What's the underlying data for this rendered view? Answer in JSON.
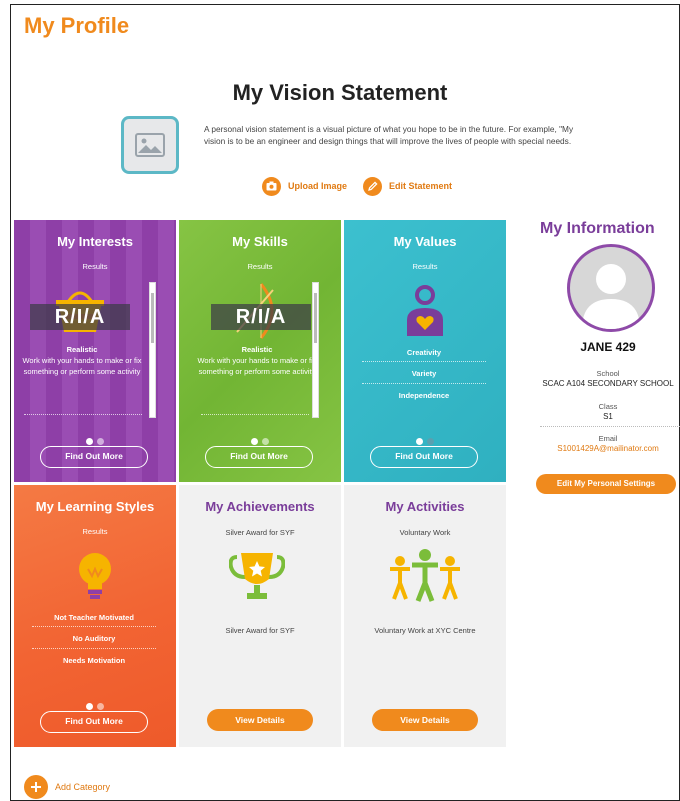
{
  "page": {
    "title": "My Profile"
  },
  "vision": {
    "title": "My Vision Statement",
    "description": "A personal vision statement is a visual picture of what you hope to be in the future. For example, \"My vision is to be an engineer and design things that will improve the lives of people with special needs.",
    "upload_label": "Upload Image",
    "edit_label": "Edit Statement"
  },
  "cards": {
    "interests": {
      "title": "My Interests",
      "results": "Results",
      "code": "R/I/A",
      "type": "Realistic",
      "desc": "Work with your hands to make or fix something or perform some activity",
      "button": "Find Out More",
      "color": "#8e3fa7"
    },
    "skills": {
      "title": "My Skills",
      "results": "Results",
      "code": "R/I/A",
      "type": "Realistic",
      "desc": "Work with your hands to make or fix something or perform some activity",
      "button": "Find Out More",
      "color": "#7bbd3a"
    },
    "values": {
      "title": "My Values",
      "results": "Results",
      "items": [
        "Creativity",
        "Variety",
        "Independence"
      ],
      "button": "Find Out More",
      "color": "#35b8c8"
    },
    "learning": {
      "title": "My Learning Styles",
      "results": "Results",
      "items": [
        "Not Teacher Motivated",
        "No Auditory",
        "Needs Motivation"
      ],
      "button": "Find Out More",
      "color": "#f26a35"
    },
    "achievements": {
      "title": "My Achievements",
      "top": "Silver Award for SYF",
      "bottom": "Silver Award for SYF",
      "button": "View Details"
    },
    "activities": {
      "title": "My Activities",
      "top": "Voluntary Work",
      "bottom": "Voluntary Work at XYC Centre",
      "button": "View Details"
    }
  },
  "info": {
    "title": "My Information",
    "name": "JANE 429",
    "school_label": "School",
    "school": "SCAC A104 SECONDARY SCHOOL",
    "class_label": "Class",
    "class": "S1",
    "email_label": "Email",
    "email": "S1001429A@mailinator.com",
    "settings_button": "Edit My Personal Settings"
  },
  "footer": {
    "add_category": "Add Category"
  },
  "colors": {
    "accent": "#f08a1d",
    "purple": "#7a3d9a",
    "grey_card": "#f1f1f1"
  },
  "icons": [
    "image-placeholder-icon",
    "camera-icon",
    "pencil-icon",
    "basket-icon",
    "bow-arrow-icon",
    "person-heart-icon",
    "lightbulb-icon",
    "trophy-icon",
    "people-icon",
    "plus-icon",
    "user-avatar-icon"
  ]
}
